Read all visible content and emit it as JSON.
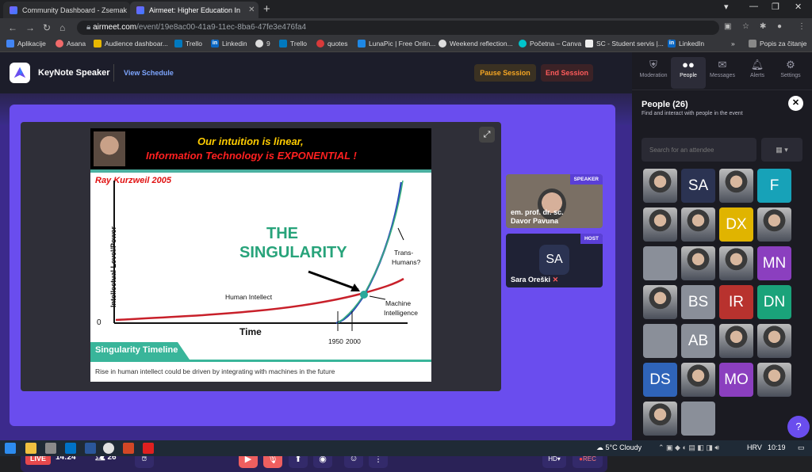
{
  "browser": {
    "tabs": [
      {
        "label": "Community Dashboard - Zsemak"
      },
      {
        "label": "Airmeet: Higher Education In"
      }
    ],
    "url_host": "airmeet.com",
    "url_path": "/event/19e8ac00-41a9-11ec-8ba6-47fe3e476fa4",
    "bookmarks": [
      "Aplikacije",
      "Asana",
      "Audience dashboar...",
      "Trello",
      "Linkedin",
      "9",
      "Trello",
      "quotes",
      "LunaPic | Free Onlin...",
      "Weekend reflection...",
      "Početna – Canva",
      "SC - Student servis |...",
      "LinkedIn"
    ],
    "reading_list": "Popis za čitanje"
  },
  "app": {
    "name": "KeyNote Speaker",
    "view_schedule": "View Schedule",
    "pause": "Pause Session",
    "end": "End Session"
  },
  "slide": {
    "line1": "Our intuition is linear,",
    "line2": "Information Technology is EXPONENTIAL !",
    "author": "Ray  Kurzweil 2005",
    "singularity1": "THE",
    "singularity2": "SINGULARITY",
    "ylabel": "Intellectual Level/Power",
    "xlabel": "Time",
    "human": "Human Intellect",
    "machine": "Machine\nIntelligence",
    "machine1": "Machine",
    "machine2": "Intelligence",
    "trans1": "Trans-",
    "trans2": "Humans?",
    "zero": "0",
    "y1950": "1950",
    "y2000": "2000",
    "timeline": "Singularity Timeline",
    "caption": "Rise in human intellect could be driven by integrating with machines in the future"
  },
  "tiles": [
    {
      "badge": "SPEAKER",
      "name": "em. prof. dr. sc. Davor Pavuna",
      "name1": "em. prof. dr. sc.",
      "name2": "Davor Pavuna"
    },
    {
      "badge": "HOST",
      "name": "Sara Oreški",
      "initials": "SA"
    }
  ],
  "controls": {
    "live": "LIVE",
    "time": "14:24",
    "count": "26",
    "hd": "HD",
    "rec": "REC"
  },
  "sidebar": {
    "tabs": [
      "Moderation",
      "People",
      "Messages",
      "Alerts",
      "Settings"
    ],
    "title": "People (26)",
    "subtitle": "Find and interact with people in the event",
    "search_placeholder": "Search for an attendee",
    "avatars": [
      "",
      "SA",
      "",
      "F",
      "",
      "",
      "DX",
      "",
      "",
      "",
      "",
      "MN",
      "",
      "BS",
      "IR",
      "DN",
      "",
      "AB",
      "",
      "",
      "DS",
      "",
      "MO",
      "",
      "",
      ""
    ]
  },
  "taskbar": {
    "weather": "5°C  Cloudy",
    "lang": "HRV",
    "time": "10:19"
  },
  "colors": {
    "accent": "#6a4dee",
    "live": "#e5484d",
    "pause": "#f5a623",
    "end": "#ff5b5b"
  }
}
